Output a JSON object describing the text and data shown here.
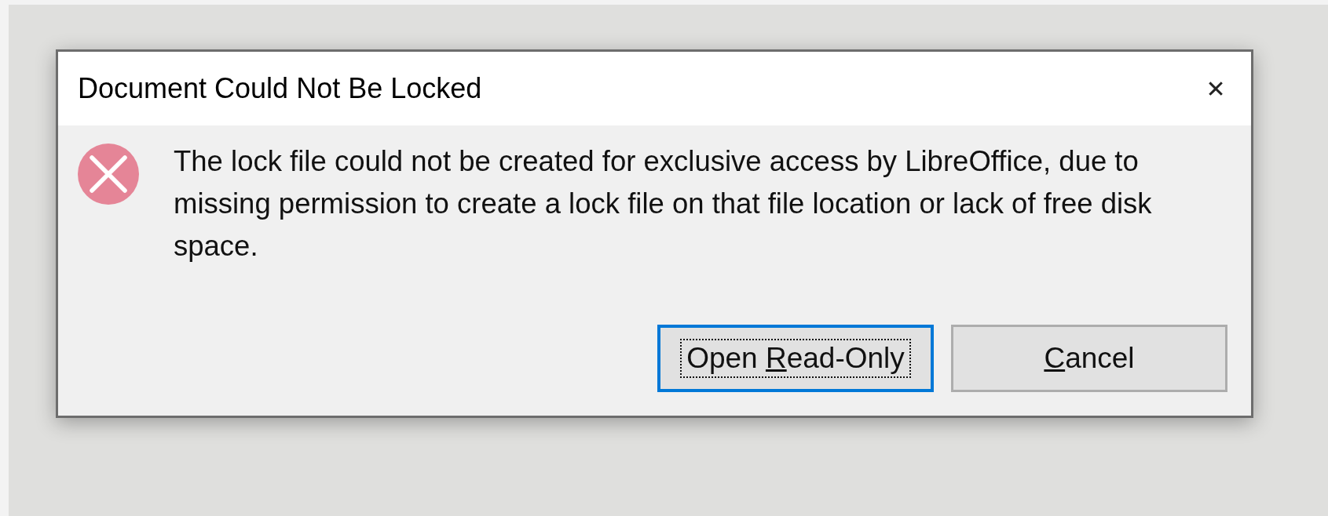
{
  "dialog": {
    "title": "Document Could Not Be Locked",
    "close_glyph": "✕",
    "icon": {
      "kind": "error"
    },
    "message": "The lock file could not be created for exclusive access by LibreOffice, due to missing permission to create a lock file on that file location or lack of free disk space.",
    "buttons": [
      {
        "label_pre": "Open ",
        "access_key": "R",
        "label_post": "ead-Only",
        "default": true
      },
      {
        "access_key": "C",
        "label_post": "ancel",
        "default": false
      }
    ]
  }
}
